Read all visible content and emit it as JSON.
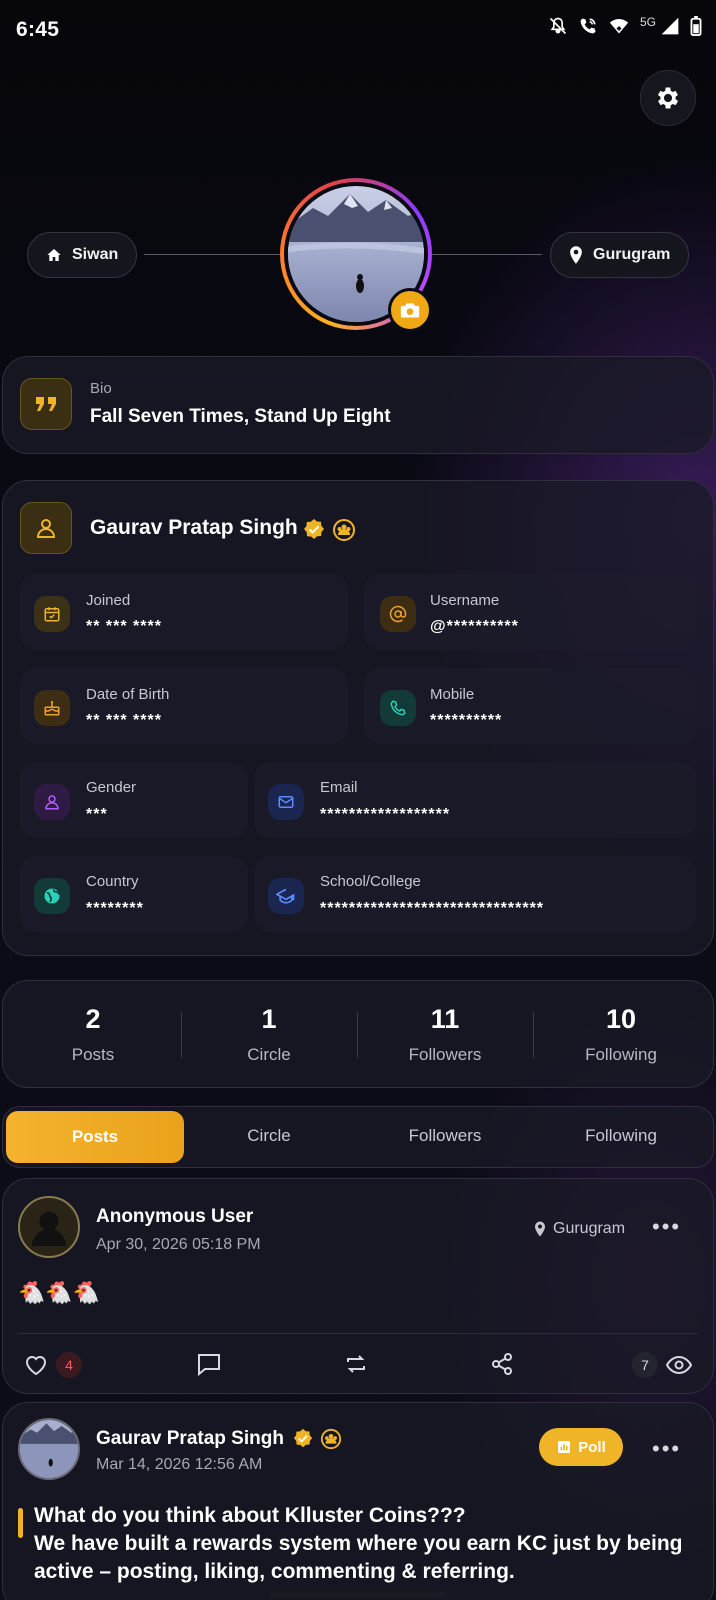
{
  "status_bar": {
    "time": "6:45",
    "network": "5G",
    "icons": [
      "mute-icon",
      "wifi-call-icon",
      "wifi-icon",
      "signal-icon",
      "battery-icon"
    ]
  },
  "header": {
    "settings_icon": "gear-icon",
    "hometown": "Siwan",
    "current_city": "Gurugram"
  },
  "bio": {
    "label": "Bio",
    "text": "Fall Seven Times, Stand Up Eight"
  },
  "profile": {
    "name": "Gaurav Pratap Singh",
    "fields": {
      "joined": {
        "label": "Joined",
        "value": "** *** ****"
      },
      "username": {
        "label": "Username",
        "value": "@**********"
      },
      "dob": {
        "label": "Date of Birth",
        "value": "** *** ****"
      },
      "mobile": {
        "label": "Mobile",
        "value": "**********"
      },
      "gender": {
        "label": "Gender",
        "value": "***"
      },
      "email": {
        "label": "Email",
        "value": "******************"
      },
      "country": {
        "label": "Country",
        "value": "********"
      },
      "school": {
        "label": "School/College",
        "value": "*******************************"
      }
    }
  },
  "stats": [
    {
      "value": "2",
      "label": "Posts"
    },
    {
      "value": "1",
      "label": "Circle"
    },
    {
      "value": "11",
      "label": "Followers"
    },
    {
      "value": "10",
      "label": "Following"
    }
  ],
  "tabs": {
    "active": "Posts",
    "items": [
      "Posts",
      "Circle",
      "Followers",
      "Following"
    ]
  },
  "posts": [
    {
      "author": "Anonymous User",
      "date": "Apr 30, 2026 05:18 PM",
      "location": "Gurugram",
      "content": "🐔🐔🐔",
      "likes": "4",
      "views": "7"
    },
    {
      "author": "Gaurav Pratap Singh",
      "date": "Mar 14, 2026 12:56 AM",
      "badge": "Poll",
      "content_line1": "What do you think about Klluster Coins???",
      "content_line2": "We have built a rewards system where you earn KC just by being active – posting, liking, commenting & referring."
    }
  ],
  "colors": {
    "accent": "#f0b429",
    "background": "#0b0b16",
    "card": "#1a1a26"
  }
}
